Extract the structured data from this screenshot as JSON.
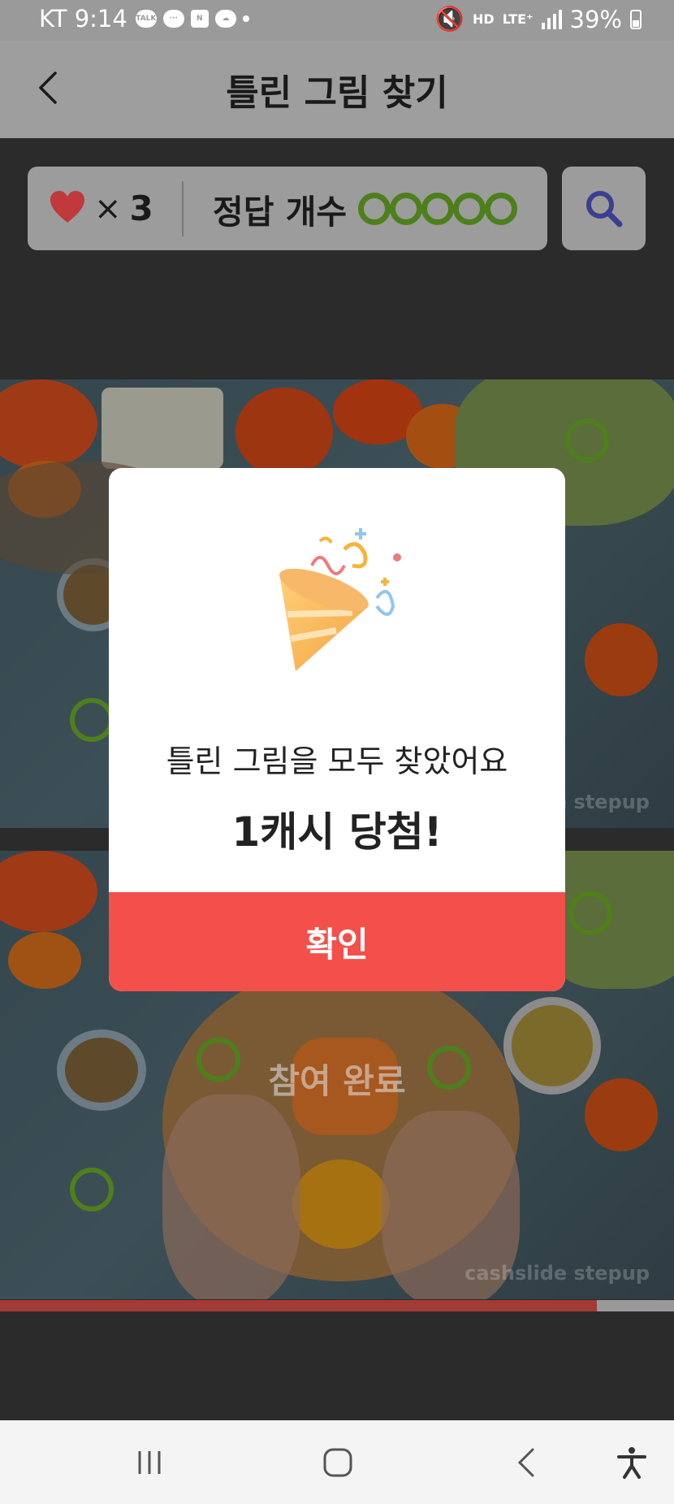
{
  "status_bar": {
    "carrier_time": "KT 9:14",
    "left_icons": [
      "TALK",
      "chat",
      "N",
      "cloud"
    ],
    "network": "HD",
    "lte": "LTE⁺",
    "battery": "39%"
  },
  "header": {
    "title": "틀린 그림 찾기"
  },
  "game": {
    "lives_x": "×",
    "lives_count": "3",
    "answer_label": "정답 개수",
    "answers_found": 5,
    "answers_total": 5
  },
  "photos": {
    "watermark": "cashslide stepup",
    "partial_watermark": "e stepup",
    "participation_status": "참여 완료",
    "progress": 0.885
  },
  "dialog": {
    "message": "틀린 그림을 모두 찾았어요",
    "reward": "1캐시 당첨!",
    "confirm": "확인"
  },
  "colors": {
    "accent": "#f3504c",
    "answer_ring": "#4e7f1c",
    "heart": "#c0393b",
    "search_icon": "#3a3f8f"
  },
  "icons": {
    "back": "chevron-left-icon",
    "heart": "heart-icon",
    "search": "search-icon",
    "party": "party-popper-icon",
    "nav_recent": "recent-apps-icon",
    "nav_home": "home-icon",
    "nav_back": "back-icon",
    "nav_accessibility": "accessibility-icon"
  }
}
